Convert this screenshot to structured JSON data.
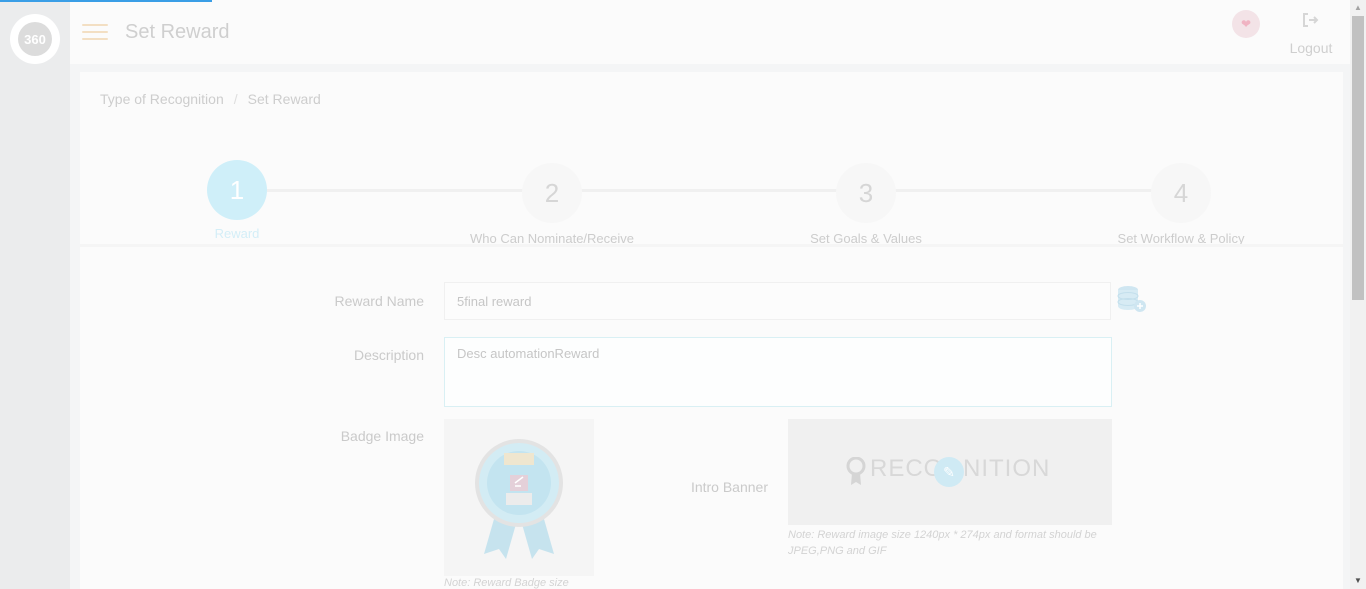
{
  "header": {
    "title": "Set Reward",
    "logo_text": "360",
    "logout_label": "Logout",
    "avatar_icon": "heart-avatar-icon"
  },
  "breadcrumb": {
    "items": [
      "Type of Recognition",
      "Set Reward"
    ],
    "separator": "/"
  },
  "stepper": {
    "steps": [
      {
        "number": "1",
        "label": "Reward",
        "active": true
      },
      {
        "number": "2",
        "label": "Who Can Nominate/Receive",
        "active": false
      },
      {
        "number": "3",
        "label": "Set Goals & Values",
        "active": false
      },
      {
        "number": "4",
        "label": "Set Workflow & Policy",
        "active": false
      }
    ]
  },
  "form": {
    "reward_name_label": "Reward Name",
    "reward_name_value": "5final reward",
    "description_label": "Description",
    "description_value": "Desc automationReward",
    "badge_image_label": "Badge Image",
    "badge_note": "Note: Reward Badge size",
    "intro_banner_label": "Intro Banner",
    "banner_text": "RECOGNITION",
    "banner_note": "Note: Reward image size 1240px * 274px and format should be JPEG,PNG and GIF"
  },
  "colors": {
    "accent": "#3a9ee6",
    "active_step": "#cfeff9"
  }
}
